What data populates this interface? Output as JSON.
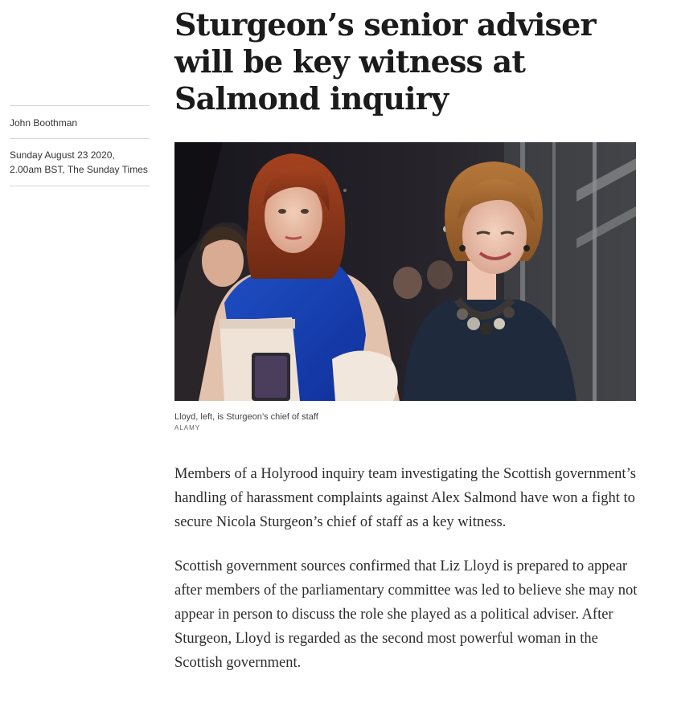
{
  "article": {
    "headline": "Sturgeon’s senior adviser will be key witness at Salmond inquiry",
    "author": "John Boothman",
    "dateline": "Sunday August 23 2020, 2.00am BST, The Sunday Times",
    "image": {
      "caption": "Lloyd, left, is Sturgeon’s chief of staff",
      "credit": "ALAMY"
    },
    "paragraphs": [
      "Members of a Holyrood inquiry team investigating the Scottish government’s handling of harassment complaints against Alex Salmond have won a fight to secure Nicola Sturgeon’s chief of staff as a key witness.",
      "Scottish government sources confirmed that Liz Lloyd is prepared to appear after members of the parliamentary committee was led to believe she may not appear in person to discuss the role she played as a political adviser. After Sturgeon, Lloyd is regarded as the second most powerful woman in the Scottish government."
    ]
  }
}
